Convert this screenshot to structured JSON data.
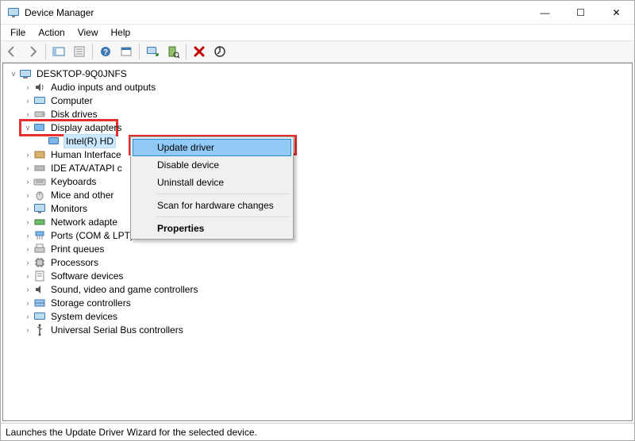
{
  "window": {
    "title": "Device Manager"
  },
  "window_controls": {
    "min": "—",
    "max": "☐",
    "close": "✕"
  },
  "menubar": {
    "items": [
      "File",
      "Action",
      "View",
      "Help"
    ]
  },
  "toolbar_semantics": {
    "back": "back-icon",
    "forward": "forward-icon",
    "show_hide": "show-hide-console-icon",
    "properties": "properties-icon",
    "help": "help-icon",
    "actions": "action-icon",
    "show_hidden": "show-hidden-icon",
    "scan": "scan-for-hardware-icon",
    "uninstall": "uninstall-icon",
    "update": "update-icon"
  },
  "tree": {
    "root": {
      "label": "DESKTOP-9Q0JNFS"
    },
    "items": [
      {
        "label": "Audio inputs and outputs",
        "collapsed": true
      },
      {
        "label": "Computer",
        "collapsed": true
      },
      {
        "label": "Disk drives",
        "collapsed": true
      },
      {
        "label": "Display adapters",
        "collapsed": false,
        "children": [
          {
            "label": "Intel(R) HD"
          }
        ]
      },
      {
        "label": "Human Interface",
        "collapsed": true
      },
      {
        "label": "IDE ATA/ATAPI c",
        "collapsed": true
      },
      {
        "label": "Keyboards",
        "collapsed": true,
        "truncated_full": "Keyboards"
      },
      {
        "label": "Mice and other",
        "collapsed": true
      },
      {
        "label": "Monitors",
        "collapsed": true
      },
      {
        "label": "Network adapte",
        "collapsed": true
      },
      {
        "label": "Ports (COM & LPT)",
        "collapsed": true
      },
      {
        "label": "Print queues",
        "collapsed": true
      },
      {
        "label": "Processors",
        "collapsed": true
      },
      {
        "label": "Software devices",
        "collapsed": true
      },
      {
        "label": "Sound, video and game controllers",
        "collapsed": true
      },
      {
        "label": "Storage controllers",
        "collapsed": true
      },
      {
        "label": "System devices",
        "collapsed": true
      },
      {
        "label": "Universal Serial Bus controllers",
        "collapsed": true
      }
    ]
  },
  "context_menu": {
    "items": [
      {
        "label": "Update driver",
        "highlighted": true
      },
      {
        "label": "Disable device"
      },
      {
        "label": "Uninstall device"
      },
      {
        "sep": true
      },
      {
        "label": "Scan for hardware changes"
      },
      {
        "sep": true
      },
      {
        "label": "Properties",
        "bold": true
      }
    ]
  },
  "statusbar": {
    "text": "Launches the Update Driver Wizard for the selected device."
  },
  "glyphs": {
    "arrow_left": "⬅",
    "arrow_right": "➡",
    "red_x": "✖",
    "circle_arrow": "↻"
  },
  "colors": {
    "highlight_bg": "#91c9f7",
    "highlight_border": "#2a8dd4",
    "annotation": "#e53030",
    "selection_bg": "#cce8ff"
  }
}
